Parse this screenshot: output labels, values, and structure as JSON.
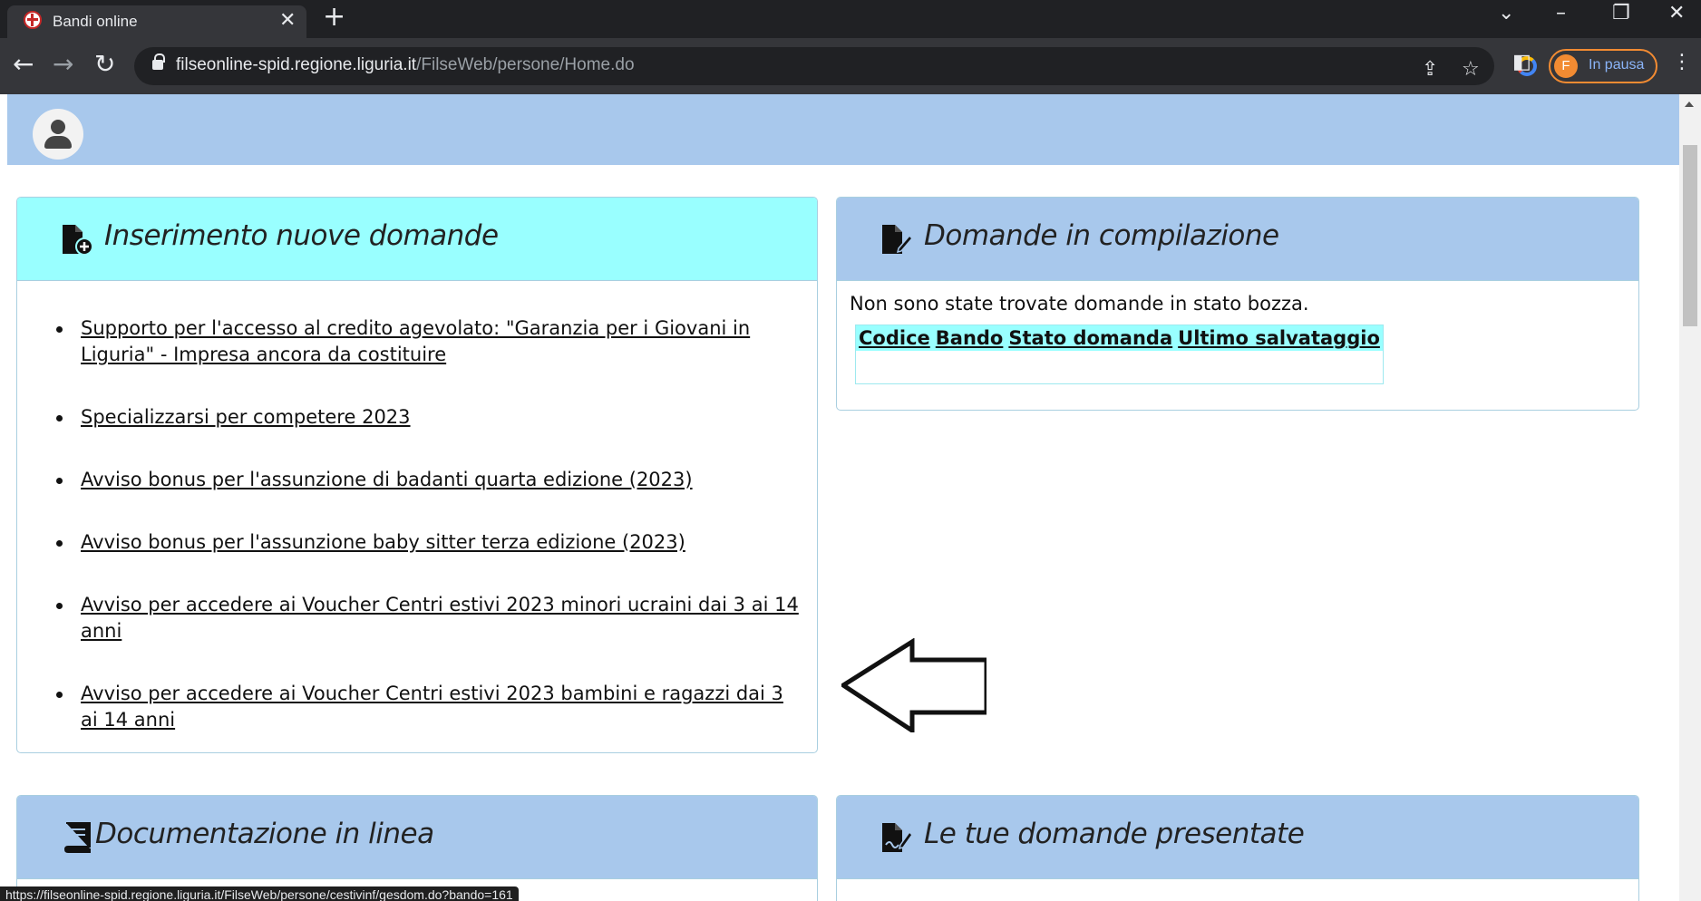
{
  "browser": {
    "tab_title": "Bandi online",
    "tab_close": "✕",
    "new_tab": "+",
    "url_host": "filseonline-spid.regione.liguria.it",
    "url_path": "/FilseWeb/persone/Home.do",
    "profile_initial": "F",
    "profile_status": "In pausa",
    "status_url": "https://filseonline-spid.regione.liguria.it/FilseWeb/persone/cestivinf/gesdom.do?bando=161"
  },
  "cards": {
    "new_applications": {
      "title": "Inserimento nuove domande",
      "items": [
        "Supporto per l'accesso al credito agevolato: \"Garanzia per i Giovani in Liguria\" - Impresa ancora da costituire",
        "Specializzarsi per competere 2023",
        "Avviso bonus per l'assunzione di badanti quarta edizione (2023)",
        "Avviso bonus per l'assunzione baby sitter terza edizione (2023)",
        "Avviso per accedere ai Voucher Centri estivi 2023 minori ucraini dai 3 ai 14 anni",
        "Avviso per accedere ai Voucher Centri estivi 2023 bambini e ragazzi dai 3 ai 14 anni"
      ]
    },
    "in_progress": {
      "title": "Domande in compilazione",
      "empty_message": "Non sono state trovate domande in stato bozza.",
      "columns": [
        "Codice",
        "Bando",
        "Stato domanda",
        "Ultimo salvataggio"
      ]
    },
    "documentation": {
      "title": "Documentazione in linea"
    },
    "submitted": {
      "title": "Le tue domande presentate"
    }
  },
  "colors": {
    "header_band": "#a8c8ec",
    "new_applications_header": "#99ffff",
    "card_header": "#a8c8ec",
    "table_header": "#99ffff"
  }
}
